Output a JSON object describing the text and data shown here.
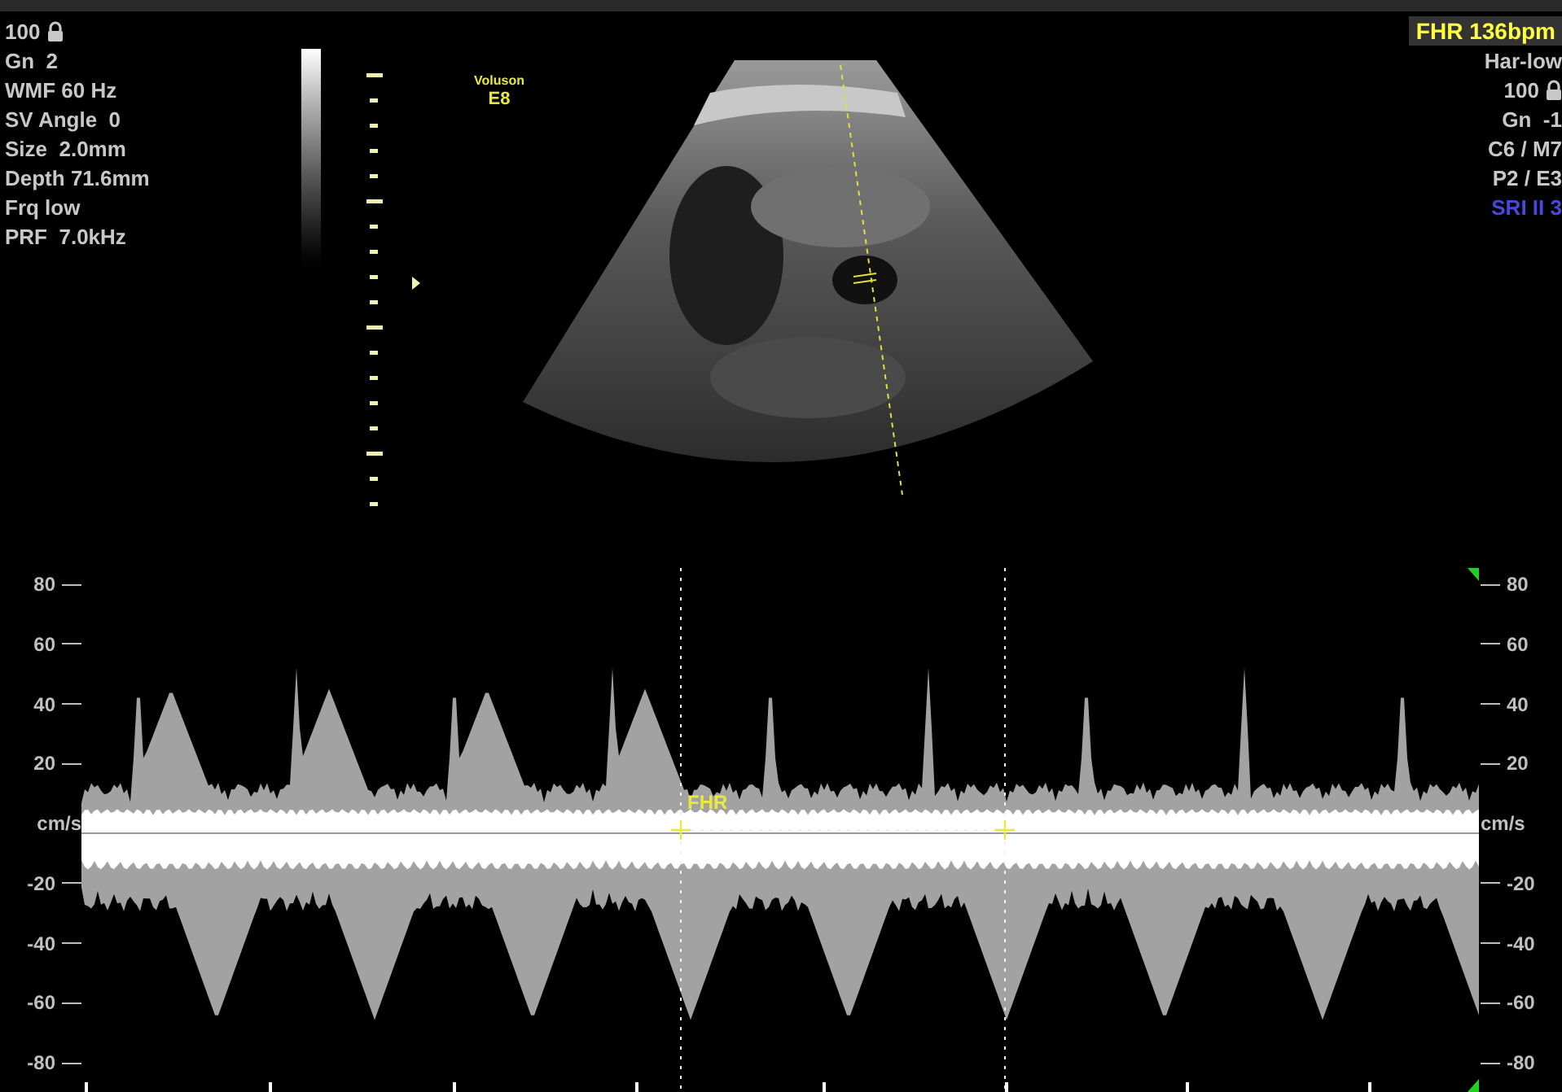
{
  "left_info": [
    {
      "text": "100",
      "kind": "locked"
    },
    {
      "text": "Gn  2",
      "kind": "plain"
    },
    {
      "text": "WMF 60 Hz",
      "kind": "plain"
    },
    {
      "text": "SV Angle  0",
      "kind": "plain"
    },
    {
      "text": "Size  2.0mm",
      "kind": "plain"
    },
    {
      "text": "Depth 71.6mm",
      "kind": "plain"
    },
    {
      "text": "Frq low",
      "kind": "plain"
    },
    {
      "text": "PRF  7.0kHz",
      "kind": "plain"
    }
  ],
  "logo": {
    "line_1": "Voluson",
    "line_2": "E8"
  },
  "right_info": {
    "heart_rate": "FHR 136bpm",
    "lines": [
      {
        "text": "Har-low",
        "kind": "plain",
        "color": "#c8c8c8"
      },
      {
        "text": "100",
        "kind": "locked",
        "color": "#c8c8c8"
      },
      {
        "text": "Gn  -1",
        "kind": "plain",
        "color": "#c8c8c8"
      },
      {
        "text": "C6 / M7",
        "kind": "plain",
        "color": "#c8c8c8"
      },
      {
        "text": "P2 / E3",
        "kind": "plain",
        "color": "#c8c8c8"
      },
      {
        "text": "SRI II 3",
        "kind": "plain",
        "color": "#4848e0"
      }
    ]
  },
  "spectrum": {
    "marker_label": "FHR",
    "left_scale": [
      "80",
      "60",
      "40",
      "20",
      "cm/s",
      "-20",
      "-40",
      "-60",
      "-80"
    ],
    "right_scale": [
      "80",
      "60",
      "40",
      "20",
      "cm/s",
      "-20",
      "-40",
      "-60",
      "-80"
    ]
  }
}
